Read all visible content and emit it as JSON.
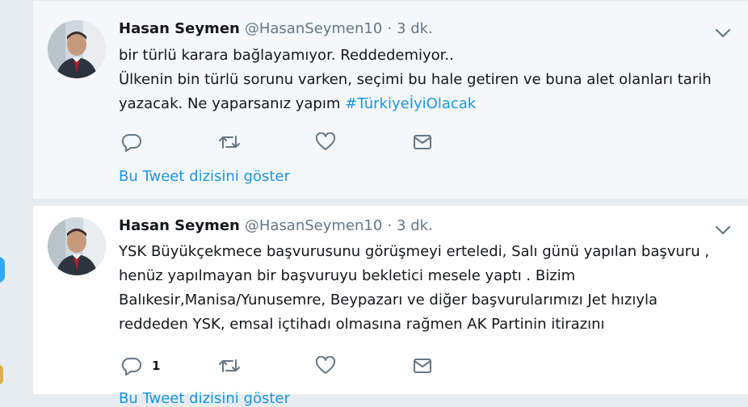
{
  "colors": {
    "accent": "#1b95e0",
    "text": "#14171a",
    "muted": "#657786",
    "background": "#e6ecf0"
  },
  "tweets": [
    {
      "name": "Hasan Seymen",
      "handle": "@HasanSeymen10",
      "separator": "·",
      "time": "3 dk.",
      "line1": "bir türlü karara bağlayamıyor. Reddedemiyor..",
      "line2": "Ülkenin bin türlü sorunu varken, seçimi bu hale getiren ve buna alet olanları tarih",
      "line3": "yazacak. Ne yaparsanız yapım",
      "hashtag": "#TürkiyeİyiOlacak",
      "reply_count": "",
      "thread_link": "Bu Tweet dizisini göster"
    },
    {
      "name": "Hasan Seymen",
      "handle": "@HasanSeymen10",
      "separator": "·",
      "time": "3 dk.",
      "line1": "YSK Büyükçekmece başvurusunu görüşmeyi erteledi, Salı günü yapılan başvuru ,",
      "line2": "henüz yapılmayan bir başvuruyu bekletici mesele yaptı . Bizim",
      "line3": "Balıkesir,Manisa/Yunusemre, Beypazarı ve diğer başvurularımızı Jet hızıyla",
      "line4": "reddeden YSK, emsal içtihadı olmasına rağmen AK Partinin itirazını",
      "reply_count": "1",
      "thread_link": "Bu Tweet dizisini göster"
    }
  ],
  "icons": {
    "reply": "reply-icon",
    "retweet": "retweet-icon",
    "like": "like-icon",
    "message": "message-icon",
    "caret": "chevron-down-icon"
  }
}
